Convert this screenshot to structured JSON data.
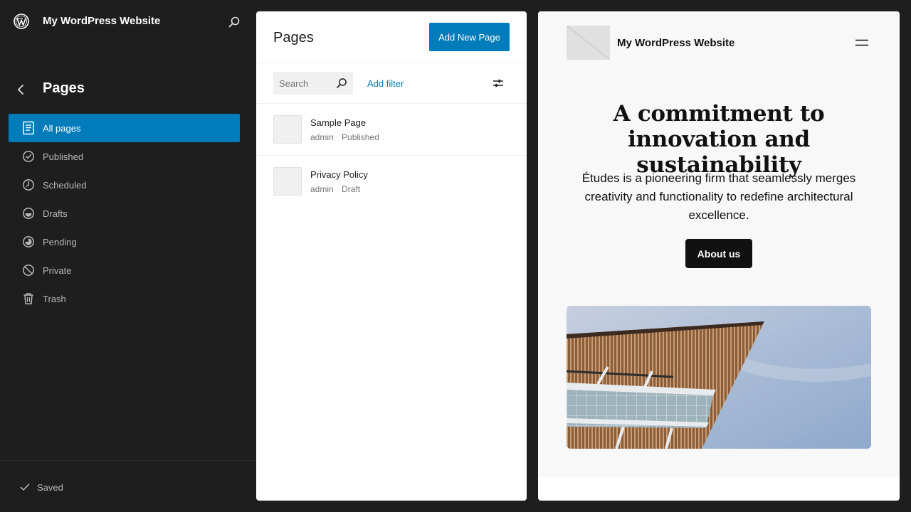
{
  "site": {
    "title": "My WordPress Website"
  },
  "sidebar": {
    "section_title": "Pages",
    "items": [
      {
        "label": "All pages",
        "icon": "pages-icon",
        "active": true
      },
      {
        "label": "Published",
        "icon": "published-icon"
      },
      {
        "label": "Scheduled",
        "icon": "scheduled-icon"
      },
      {
        "label": "Drafts",
        "icon": "drafts-icon"
      },
      {
        "label": "Pending",
        "icon": "pending-icon"
      },
      {
        "label": "Private",
        "icon": "private-icon"
      },
      {
        "label": "Trash",
        "icon": "trash-icon"
      }
    ],
    "footer_status": "Saved"
  },
  "pages_panel": {
    "title": "Pages",
    "add_button": "Add New Page",
    "search_placeholder": "Search",
    "add_filter": "Add filter",
    "rows": [
      {
        "title": "Sample Page",
        "author": "admin",
        "status": "Published"
      },
      {
        "title": "Privacy Policy",
        "author": "admin",
        "status": "Draft"
      }
    ]
  },
  "preview": {
    "site_title": "My WordPress Website",
    "heading": "A commitment to innovation and sustainability",
    "body": "Études is a pioneering firm that seamlessly merges creativity and functionality to redefine architectural excellence.",
    "button": "About us"
  },
  "colors": {
    "sidebar_bg": "#1e1e1e",
    "accent": "#007cba",
    "preview_button": "#111111"
  }
}
